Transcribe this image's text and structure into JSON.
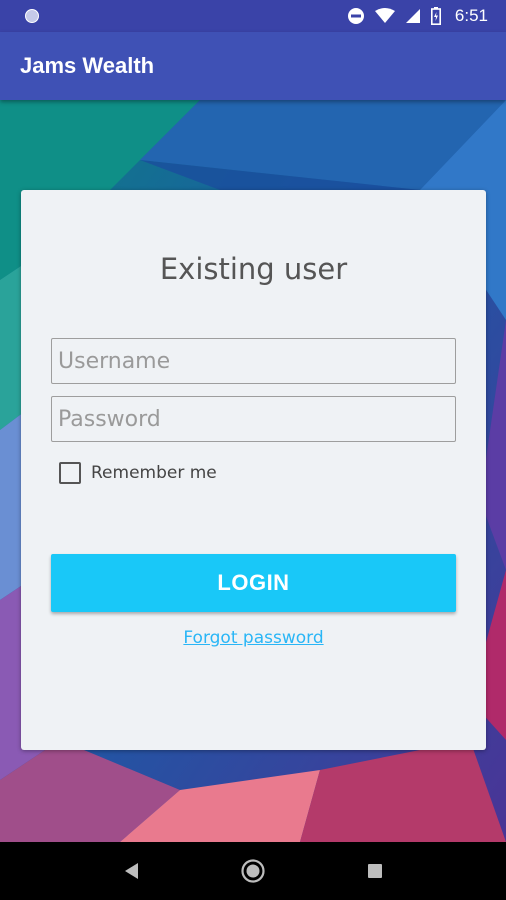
{
  "status_bar": {
    "time": "6:51",
    "icons": [
      "notification-dot-icon",
      "do-not-disturb-icon",
      "wifi-icon",
      "signal-icon",
      "battery-icon"
    ]
  },
  "app_bar": {
    "title": "Jams Wealth",
    "color": "#3f51b5"
  },
  "login_card": {
    "title": "Existing user",
    "username_placeholder": "Username",
    "password_placeholder": "Password",
    "remember_label": "Remember me",
    "login_label": "LOGIN",
    "forgot_label": "Forgot password",
    "accent_color": "#19c8f8"
  },
  "nav_bar": {
    "icons": [
      "back-icon",
      "home-icon",
      "recents-icon"
    ]
  }
}
